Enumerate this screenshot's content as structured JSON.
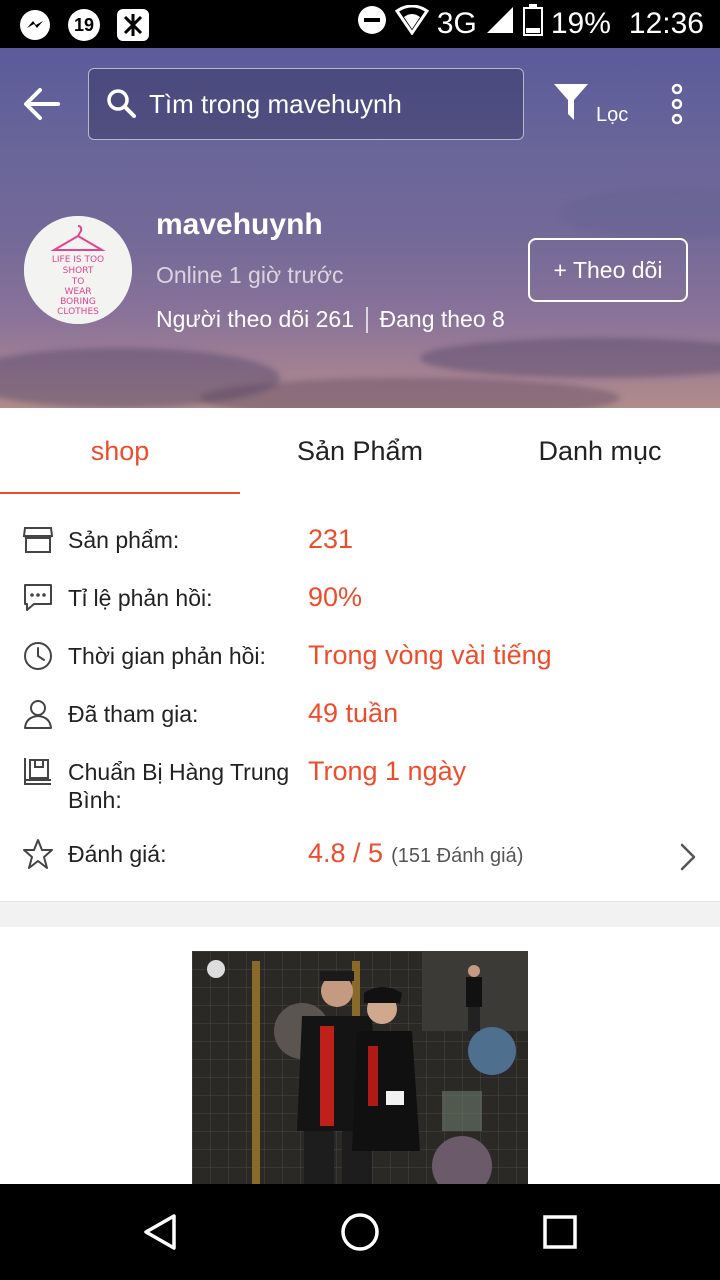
{
  "status_bar": {
    "notification_count": "19",
    "network": "3G",
    "battery": "19%",
    "time": "12:36"
  },
  "header": {
    "search_placeholder": "Tìm trong mavehuynh",
    "filter_label": "Lọc"
  },
  "shop": {
    "name": "mavehuynh",
    "online_status": "Online 1 giờ trước",
    "followers": "Người theo dõi 261",
    "following": "Đang theo 8",
    "follow_button": "+ Theo dõi",
    "avatar_text": "LIFE IS TOO SHORT TO WEAR BORING CLOTHES"
  },
  "tabs": [
    {
      "label": "shop",
      "active": true
    },
    {
      "label": "Sản Phẩm",
      "active": false
    },
    {
      "label": "Danh mục",
      "active": false
    }
  ],
  "info": [
    {
      "icon": "store-icon",
      "label": "Sản phẩm:",
      "value": "231"
    },
    {
      "icon": "chat-icon",
      "label": "Tỉ lệ phản hồi:",
      "value": "90%"
    },
    {
      "icon": "clock-icon",
      "label": "Thời gian phản hồi:",
      "value": "Trong vòng vài tiếng"
    },
    {
      "icon": "user-icon",
      "label": "Đã tham gia:",
      "value": "49 tuần"
    },
    {
      "icon": "package-icon",
      "label": "Chuẩn Bị Hàng Trung Bình:",
      "value": "Trong 1 ngày"
    },
    {
      "icon": "star-icon",
      "label": "Đánh giá:",
      "value": "4.8 / 5",
      "count": "(151 Đánh giá)"
    }
  ],
  "colors": {
    "accent": "#ee4d2d",
    "status_bar": "#000000",
    "nav_bar": "#000000"
  }
}
